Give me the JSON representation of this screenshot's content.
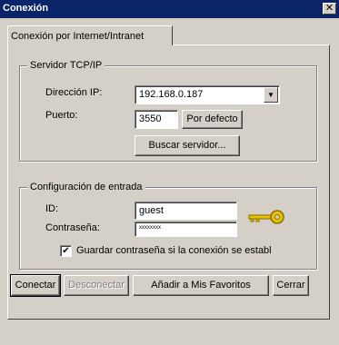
{
  "window": {
    "title": "Conexión",
    "close_glyph": "✕"
  },
  "tab": {
    "label": "Conexión por Internet/Intranet"
  },
  "tcp_group": {
    "legend": "Servidor TCP/IP",
    "ip_label": "Dirección IP:",
    "ip_value": "192.168.0.187",
    "port_label": "Puerto:",
    "port_value": "3550",
    "default_button": "Por defecto",
    "search_button": "Buscar servidor..."
  },
  "login_group": {
    "legend": "Configuración de entrada",
    "id_label": "ID:",
    "id_value": "guest",
    "password_label": "Contraseña:",
    "password_value": "xxxxxxxx",
    "save_password_label": "Guardar contraseña si la conexión se establ",
    "save_password_checked": true,
    "key_icon": "key-icon",
    "key_color": "#e8c200"
  },
  "buttons": {
    "connect": "Conectar",
    "disconnect": "Desconectar",
    "add_favorites": "Añadir a Mis Favoritos",
    "close": "Cerrar"
  }
}
